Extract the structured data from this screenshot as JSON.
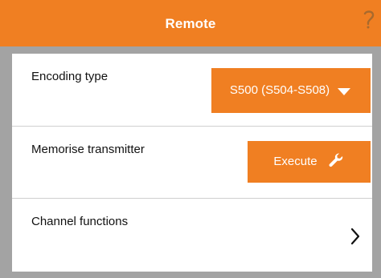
{
  "header": {
    "title": "Remote",
    "help_icon": "help-icon",
    "bg_color": "#f07f22"
  },
  "rows": [
    {
      "label": "Encoding type",
      "control": {
        "type": "dropdown",
        "value": "S500 (S504-S508)",
        "icon": "chevron-down-icon"
      }
    },
    {
      "label": "Memorise transmitter",
      "control": {
        "type": "button",
        "label": "Execute",
        "icon": "wrench-icon"
      }
    },
    {
      "label": "Channel functions",
      "control": {
        "type": "navigation",
        "icon": "chevron-right-icon"
      }
    }
  ],
  "colors": {
    "accent": "#f07f22",
    "background": "#a3a3a3",
    "panel": "#ffffff",
    "divider": "#cfcfcf"
  }
}
